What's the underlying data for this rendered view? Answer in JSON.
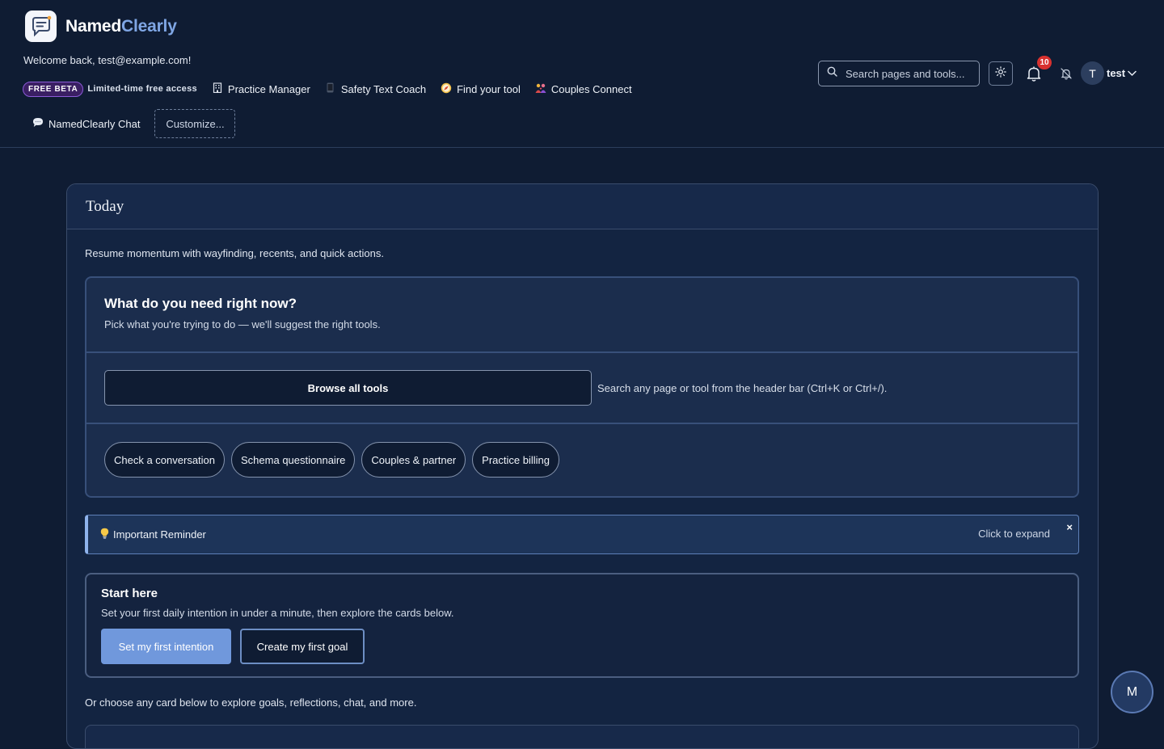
{
  "brand": {
    "name_part1": "Named",
    "name_part2": "Clearly"
  },
  "header": {
    "welcome": "Welcome back, test@example.com!",
    "beta_badge": "FREE BETA",
    "beta_text": "Limited-time free access",
    "nav": [
      {
        "label": "Practice Manager",
        "icon": "building-icon"
      },
      {
        "label": "Safety Text Coach",
        "icon": "phone-icon"
      },
      {
        "label": "Find your tool",
        "icon": "compass-icon"
      },
      {
        "label": "Couples Connect",
        "icon": "people-icon"
      }
    ],
    "chat_link": "NamedClearly Chat",
    "customize": "Customize...",
    "search_placeholder": "Search pages and tools...",
    "notification_count": "10",
    "user_initial": "T",
    "username": "test"
  },
  "main": {
    "title": "Today",
    "subtitle": "Resume momentum with wayfinding, recents, and quick actions.",
    "need": {
      "title": "What do you need right now?",
      "desc": "Pick what you're trying to do — we'll suggest the right tools.",
      "browse": "Browse all tools",
      "hint": "Search any page or tool from the header bar (Ctrl+K or Ctrl+/).",
      "chips": [
        "Check a conversation",
        "Schema questionnaire",
        "Couples & partner",
        "Practice billing"
      ]
    },
    "reminder": {
      "label": "Important Reminder",
      "expand": "Click to expand",
      "close": "×"
    },
    "start": {
      "title": "Start here",
      "desc": "Set your first daily intention in under a minute, then explore the cards below.",
      "primary": "Set my first intention",
      "secondary": "Create my first goal"
    },
    "explore": "Or choose any card below to explore goals, reflections, chat, and more."
  },
  "fab": {
    "label": "M"
  },
  "colors": {
    "background": "#0f1c33",
    "accent": "#7098dc",
    "brand_accent": "#7fa6e4",
    "badge": "#d8312f"
  }
}
